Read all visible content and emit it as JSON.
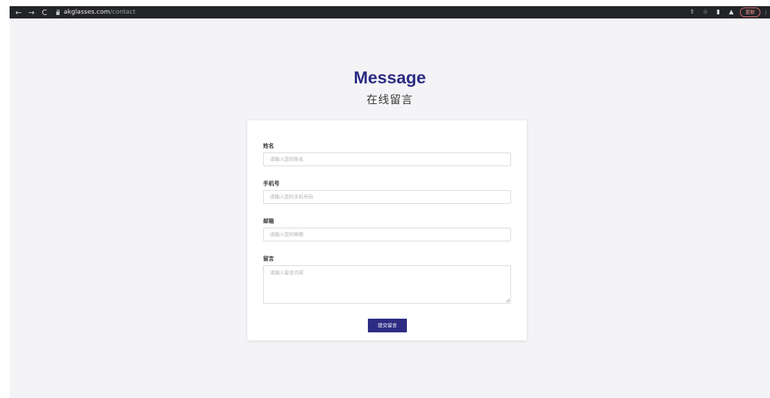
{
  "browser": {
    "url_host": "akglasses.com",
    "url_path": "/contact",
    "update_label": "更新",
    "icons": {
      "back": "←",
      "forward": "→",
      "reload": "C",
      "share": "⇪",
      "bookmark": "☆",
      "sidepanel": "▮",
      "profile": "▲",
      "menu": "⋮"
    }
  },
  "page": {
    "title": "Message",
    "subtitle": "在线留言"
  },
  "form": {
    "name": {
      "label": "姓名",
      "placeholder": "请输入您的姓名"
    },
    "phone": {
      "label": "手机号",
      "placeholder": "请输入您的手机号码"
    },
    "email": {
      "label": "邮箱",
      "placeholder": "请输入您的邮箱"
    },
    "message": {
      "label": "留言",
      "placeholder": "请输入留言内容"
    },
    "submit_label": "提交留言"
  },
  "colors": {
    "brand": "#2d2c83",
    "background": "#f4f4f7",
    "chrome": "#232428"
  }
}
